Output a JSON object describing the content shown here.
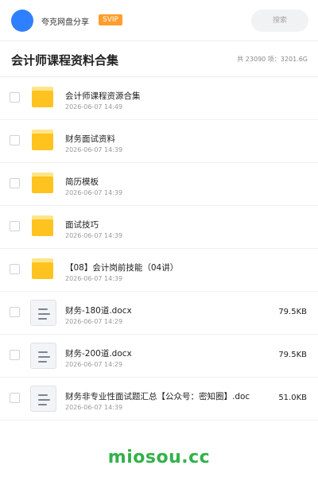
{
  "header": {
    "brand": "夸克网盘分享",
    "badge": "SVIP",
    "search_placeholder": "搜索"
  },
  "title": "会计师课程资料合集",
  "stats": "共 23090 项：3201.6G",
  "colors": {
    "avatar": "#2f80ff",
    "badge": "#ff9e2c",
    "folder": "#ffc31f",
    "watermark": "#33b14a"
  },
  "files": [
    {
      "type": "folder",
      "icon": "folder-icon",
      "name": "会计师课程资源合集",
      "date": "2026-06-07 14:49",
      "size": ""
    },
    {
      "type": "folder",
      "icon": "folder-icon",
      "name": "财务面试资料",
      "date": "2026-06-07 14:39",
      "size": ""
    },
    {
      "type": "folder",
      "icon": "folder-icon",
      "name": "简历模板",
      "date": "2026-06-07 14:39",
      "size": ""
    },
    {
      "type": "folder",
      "icon": "folder-icon",
      "name": "面试技巧",
      "date": "2026-06-07 14:39",
      "size": ""
    },
    {
      "type": "folder",
      "icon": "folder-icon",
      "name": "【08】会计岗前技能（04讲）",
      "date": "2026-06-07 14:39",
      "size": ""
    },
    {
      "type": "doc",
      "icon": "document-icon",
      "name": "财务-180道.docx",
      "date": "2026-06-07 14:29",
      "size": "79.5KB"
    },
    {
      "type": "doc",
      "icon": "document-icon",
      "name": "财务-200道.docx",
      "date": "2026-06-07 14:29",
      "size": "79.5KB"
    },
    {
      "type": "doc",
      "icon": "document-icon",
      "name": "财务非专业性面试题汇总【公众号：密知圈】.doc",
      "date": "2026-06-07 14:39",
      "size": "51.0KB"
    }
  ],
  "watermark": "miosou.cc"
}
